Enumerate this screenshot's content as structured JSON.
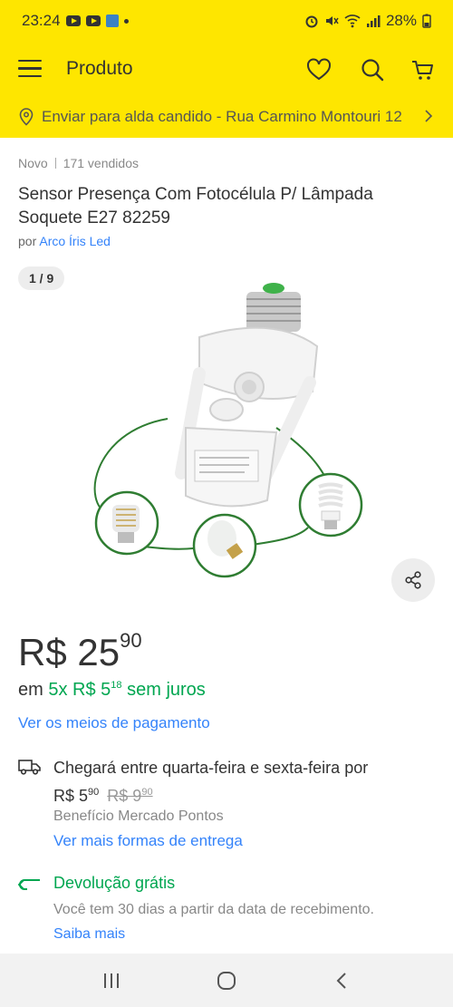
{
  "status_bar": {
    "time": "23:24",
    "battery": "28%"
  },
  "app_bar": {
    "title": "Produto",
    "icons": [
      "menu-icon",
      "heart-icon",
      "search-icon",
      "cart-icon"
    ]
  },
  "address": {
    "text": "Enviar para alda candido - Rua Carmino Montouri 12"
  },
  "product": {
    "condition": "Novo",
    "sold": "171 vendidos",
    "title": "Sensor Presença Com Fotocélula P/ Lâmpada Soquete E27 82259",
    "seller_prefix": "por",
    "seller_name": "Arco Íris Led",
    "image_counter": "1 / 9"
  },
  "price": {
    "currency": "R$",
    "integer": "25",
    "cents": "90"
  },
  "installment": {
    "prefix": "em",
    "text": "5x R$ 5",
    "cents": "18",
    "suffix": "sem juros"
  },
  "payment_link": "Ver os meios de pagamento",
  "shipping": {
    "prefix": "Chegará",
    "window": "entre quarta-feira e sexta-feira",
    "by": "por",
    "price_currency": "R$ 5",
    "price_cents": "90",
    "old_price_currency": "R$ 9",
    "old_price_cents": "90",
    "benefit": "Benefício Mercado Pontos",
    "link": "Ver mais formas de entrega"
  },
  "returns": {
    "title": "Devolução grátis",
    "description": "Você tem 30 dias a partir da data de recebimento.",
    "link": "Saiba mais"
  },
  "colors": {
    "brand_yellow": "#fee600",
    "link_blue": "#3483fa",
    "green": "#00a650"
  }
}
